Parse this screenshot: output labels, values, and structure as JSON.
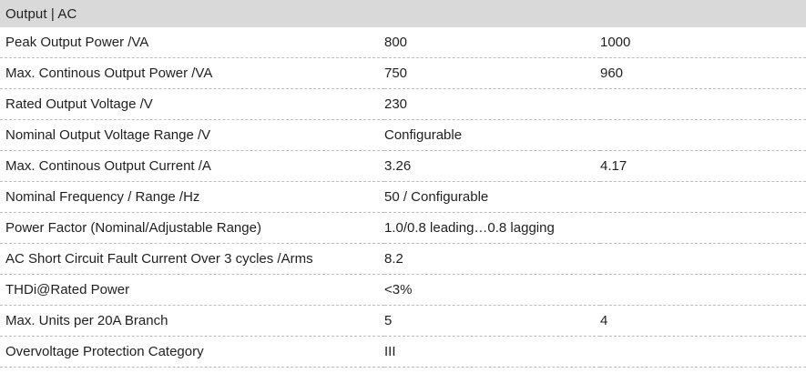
{
  "header": {
    "title": "Output | AC"
  },
  "rows": [
    {
      "param": "Peak Output Power /VA",
      "v1": "800",
      "v2": "1000"
    },
    {
      "param": "Max. Continous Output Power /VA",
      "v1": "750",
      "v2": "960"
    },
    {
      "param": "Rated Output Voltage /V",
      "v1": "230",
      "v2": ""
    },
    {
      "param": "Nominal Output Voltage Range /V",
      "v1": "Configurable",
      "v2": ""
    },
    {
      "param": "Max. Continous Output Current /A",
      "v1": "3.26",
      "v2": "4.17"
    },
    {
      "param": "Nominal Frequency / Range /Hz",
      "v1": "50 / Configurable",
      "v2": ""
    },
    {
      "param": "Power Factor (Nominal/Adjustable Range)",
      "v1": "1.0/0.8 leading…0.8 lagging",
      "v2": ""
    },
    {
      "param": "AC Short Circuit Fault Current Over 3 cycles /Arms",
      "v1": "8.2",
      "v2": ""
    },
    {
      "param": "THDi@Rated Power",
      "v1": "<3%",
      "v2": ""
    },
    {
      "param": "Max. Units per 20A Branch",
      "v1": "5",
      "v2": "4"
    },
    {
      "param": "Overvoltage Protection Category",
      "v1": "III",
      "v2": ""
    }
  ]
}
